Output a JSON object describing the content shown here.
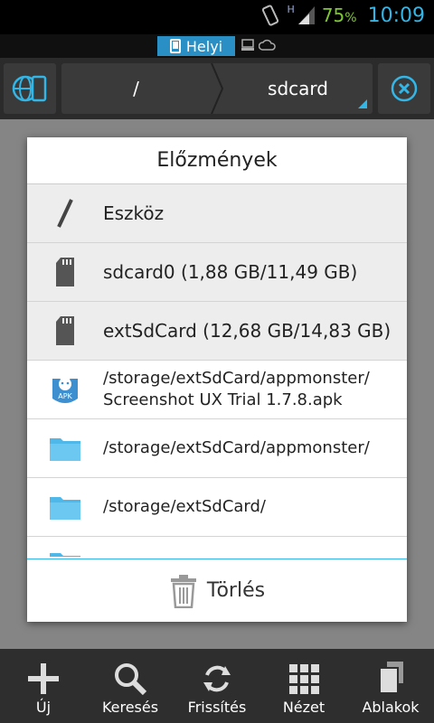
{
  "status_bar": {
    "network_label": "H",
    "battery": "75",
    "battery_unit": "%",
    "time": "10:09"
  },
  "tabs": {
    "local_label": "Helyi"
  },
  "toolbar": {
    "crumbs": [
      "/",
      "sdcard"
    ]
  },
  "dialog": {
    "title": "Előzmények",
    "items": [
      {
        "icon": "slash-icon",
        "label": "Eszköz"
      },
      {
        "icon": "sd-card-icon",
        "label": "sdcard0 (1,88 GB/11,49 GB)"
      },
      {
        "icon": "sd-card-icon",
        "label": "extSdCard (12,68 GB/14,83 GB)"
      },
      {
        "icon": "apk-icon",
        "label": "/storage/extSdCard/appmonster/\nScreenshot UX Trial 1.7.8.apk"
      },
      {
        "icon": "folder-icon",
        "label": "/storage/extSdCard/appmonster/"
      },
      {
        "icon": "folder-icon",
        "label": "/storage/extSdCard/"
      },
      {
        "icon": "folder-icon",
        "label": ""
      }
    ],
    "clear_label": "Törlés"
  },
  "bottom_bar": {
    "items": [
      {
        "icon": "plus-icon",
        "label": "Új"
      },
      {
        "icon": "search-icon",
        "label": "Keresés"
      },
      {
        "icon": "refresh-icon",
        "label": "Frissítés"
      },
      {
        "icon": "grid-icon",
        "label": "Nézet"
      },
      {
        "icon": "windows-icon",
        "label": "Ablakok"
      }
    ]
  },
  "colors": {
    "accent": "#33b5e5",
    "tab_active": "#2a8fc4",
    "battery": "#7ec832"
  }
}
